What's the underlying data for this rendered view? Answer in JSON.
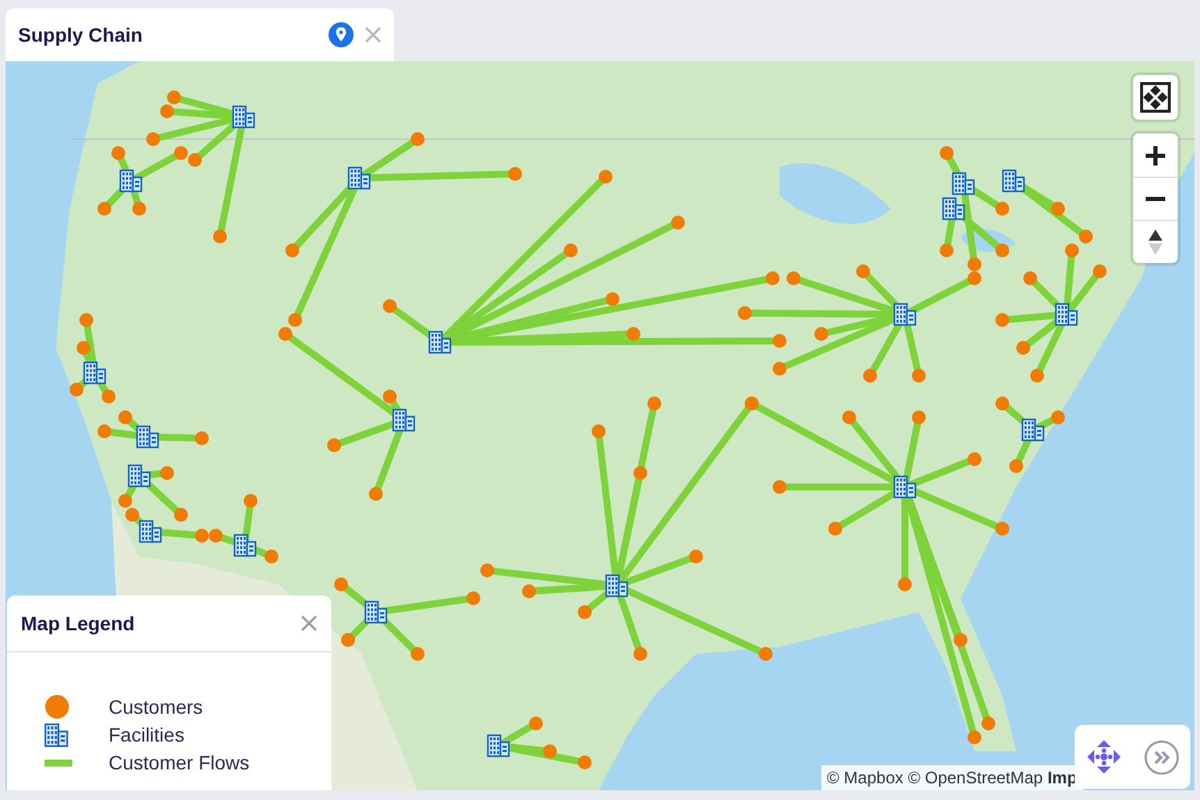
{
  "tab": {
    "title": "Supply Chain"
  },
  "legend": {
    "title": "Map Legend",
    "items": [
      {
        "label": "Customers",
        "kind": "customer"
      },
      {
        "label": "Facilities",
        "kind": "facility"
      },
      {
        "label": "Customer Flows",
        "kind": "flow"
      }
    ]
  },
  "attribution": "© Mapbox © OpenStreetMap **Imp**"
}
